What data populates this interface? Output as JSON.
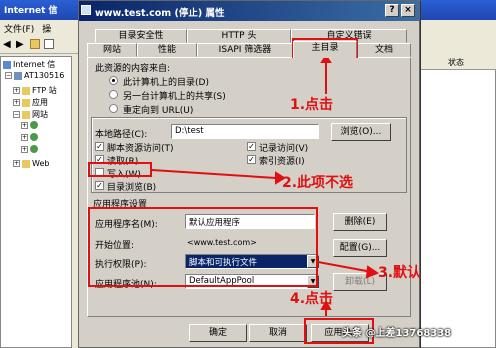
{
  "background": {
    "title": "Internet 信",
    "menu": [
      "文件(F)",
      "操"
    ],
    "tree": [
      "AT130516",
      "FTP 站",
      "应用",
      "网站",
      "Web"
    ],
    "right_header": "状态"
  },
  "dialog": {
    "title": "www.test.com (停止) 属性",
    "help_button": "?",
    "close_button": "×",
    "tabs_row1": [
      "目录安全性",
      "HTTP 头",
      "自定义错误"
    ],
    "tabs_row2": [
      "网站",
      "性能",
      "ISAPI 筛选器",
      "主目录",
      "文档"
    ],
    "content_source_label": "此资源的内容来自:",
    "radios": [
      "此计算机上的目录(D)",
      "另一台计算机上的共享(S)",
      "重定向到 URL(U)"
    ],
    "local_path_label": "本地路径(C):",
    "local_path_value": "D:\\test",
    "browse_button": "浏览(O)...",
    "checks_left": [
      {
        "label": "脚本资源访问(T)",
        "checked": true
      },
      {
        "label": "读取(R)",
        "checked": true
      },
      {
        "label": "写入(W)",
        "checked": false
      },
      {
        "label": "目录浏览(B)",
        "checked": true
      }
    ],
    "checks_right": [
      {
        "label": "记录访问(V)",
        "checked": true
      },
      {
        "label": "索引资源(I)",
        "checked": true
      }
    ],
    "app_settings_label": "应用程序设置",
    "app_name_label": "应用程序名(M):",
    "app_name_value": "默认应用程序",
    "start_point_label": "开始位置:",
    "start_point_value": "<www.test.com>",
    "exec_perm_label": "执行权限(P):",
    "exec_perm_value": "脚本和可执行文件",
    "app_pool_label": "应用程序池(N):",
    "app_pool_value": "DefaultAppPool",
    "remove_button": "删除(E)",
    "config_button": "配置(G)...",
    "unload_button": "卸载(L)",
    "ok_button": "确定",
    "cancel_button": "取消",
    "apply_button": "应用(A)"
  },
  "annotations": {
    "step1": "1.点击",
    "step2": "2.此项不选",
    "step3": "3.默认",
    "step4": "4.点击",
    "watermark": "头条 @上差13768338"
  },
  "colors": {
    "annotation": "#e01010",
    "title_bar": "#0a246a"
  }
}
